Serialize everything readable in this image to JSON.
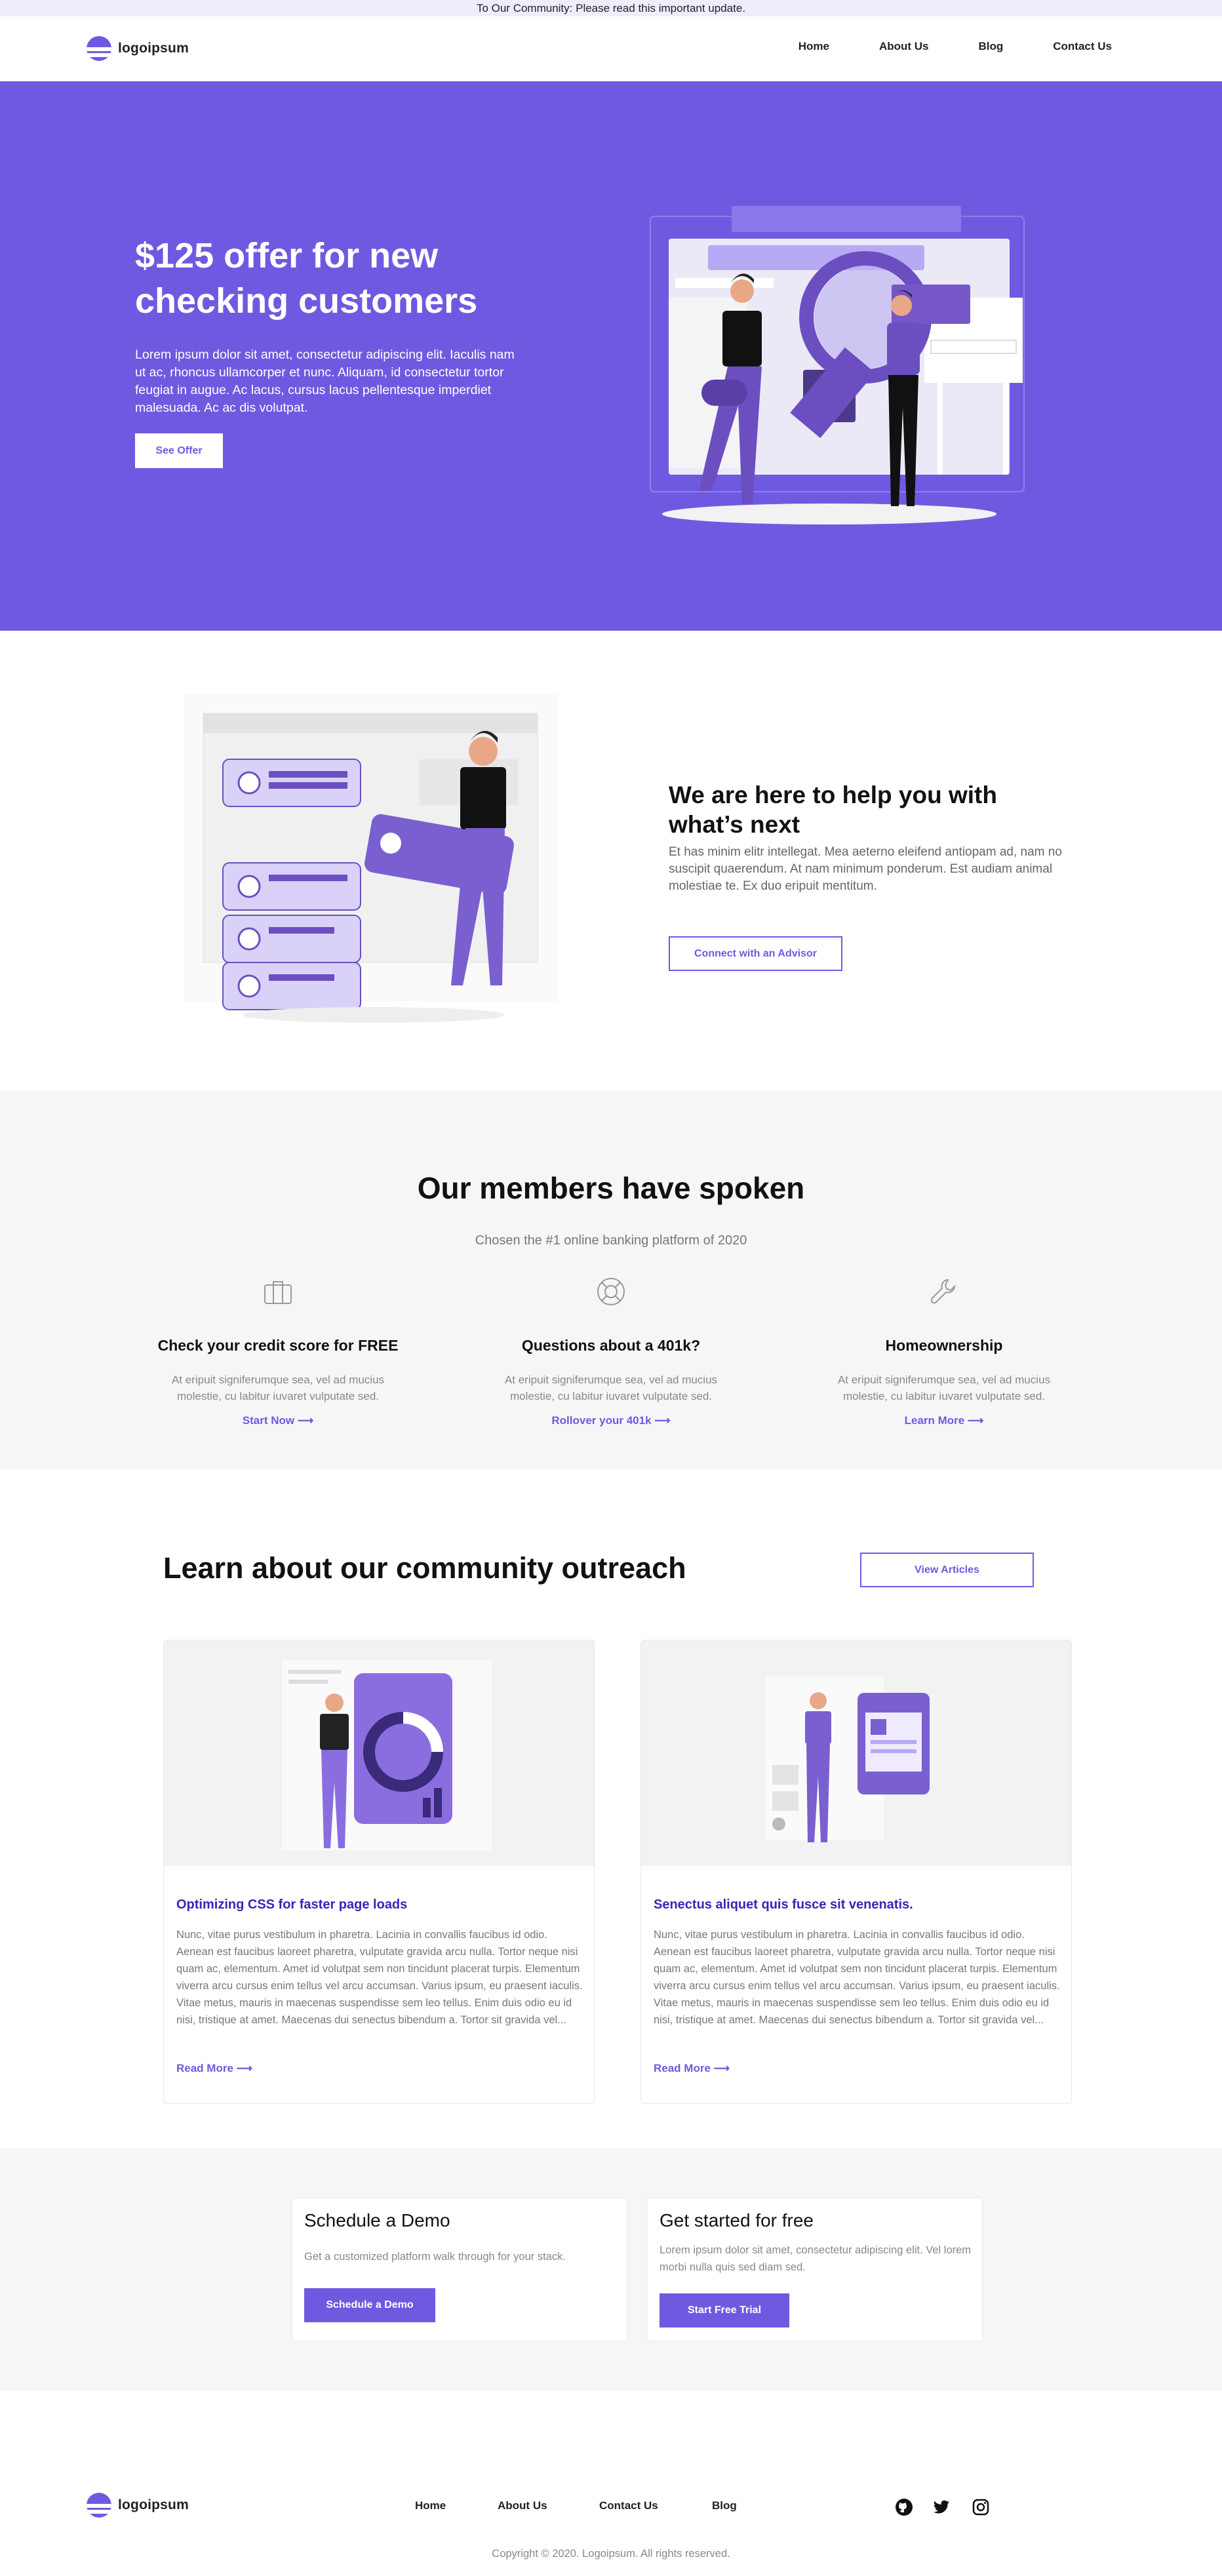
{
  "announcement": {
    "text": "To Our Community: Please read this important update."
  },
  "brand": {
    "name": "logoipsum",
    "accent": "#6e5ae0"
  },
  "nav": {
    "links": [
      "Home",
      "About Us",
      "Blog",
      "Contact Us"
    ]
  },
  "hero": {
    "title": "$125 offer for new checking customers",
    "body": "Lorem ipsum dolor sit amet, consectetur adipiscing elit. Iaculis nam ut ac, rhoncus ullamcorper et nunc. Aliquam, id consectetur tortor feugiat in augue. Ac lacus, cursus lacus pellentesque imperdiet malesuada. Ac ac dis volutpat.",
    "button": "See Offer"
  },
  "help": {
    "title": "We are here to help you with what’s next",
    "body": "Et has minim elitr intellegat. Mea aeterno eleifend antiopam ad, nam no suscipit quaerendum. At nam minimum ponderum. Est audiam animal molestiae te. Ex duo eripuit mentitum.",
    "button": "Connect with an Advisor"
  },
  "members": {
    "title": "Our members have spoken",
    "subtitle": "Chosen the #1 online banking platform of 2020",
    "features": [
      {
        "icon": "briefcase-icon",
        "title": "Check your credit score for FREE",
        "body": "At eripuit signiferumque sea, vel ad mucius molestie, cu labitur iuvaret vulputate sed.",
        "link": "Start Now ⟶"
      },
      {
        "icon": "lifebuoy-icon",
        "title": "Questions about a 401k?",
        "body": "At eripuit signiferumque sea, vel ad mucius molestie, cu labitur iuvaret vulputate sed.",
        "link": "Rollover your 401k ⟶"
      },
      {
        "icon": "wrench-icon",
        "title": "Homeownership",
        "body": "At eripuit signiferumque sea, vel ad mucius molestie, cu labitur iuvaret vulputate sed.",
        "link": "Learn More ⟶"
      }
    ]
  },
  "outreach": {
    "title": "Learn about our community outreach",
    "button": "View Articles",
    "articles": [
      {
        "title": "Optimizing CSS for faster page loads",
        "body": "Nunc, vitae purus vestibulum in pharetra. Lacinia in convallis faucibus id odio. Aenean est faucibus laoreet pharetra, vulputate gravida arcu nulla. Tortor neque nisi quam ac, elementum. Amet id volutpat sem non tincidunt placerat turpis. Elementum viverra arcu cursus enim tellus vel arcu accumsan. Varius ipsum, eu praesent iaculis. Vitae metus, mauris in maecenas suspendisse sem leo tellus. Enim duis odio eu id nisi, tristique at amet. Maecenas dui senectus bibendum a. Tortor sit gravida vel...",
        "link": "Read More ⟶"
      },
      {
        "title": "Senectus aliquet quis fusce sit venenatis.",
        "body": "Nunc, vitae purus vestibulum in pharetra. Lacinia in convallis faucibus id odio. Aenean est faucibus laoreet pharetra, vulputate gravida arcu nulla. Tortor neque nisi quam ac, elementum. Amet id volutpat sem non tincidunt placerat turpis. Elementum viverra arcu cursus enim tellus vel arcu accumsan. Varius ipsum, eu praesent iaculis. Vitae metus, mauris in maecenas suspendisse sem leo tellus. Enim duis odio eu id nisi, tristique at amet. Maecenas dui senectus bibendum a. Tortor sit gravida vel...",
        "link": "Read More ⟶"
      }
    ]
  },
  "cta": {
    "demo": {
      "title": "Schedule a Demo",
      "body": "Get a customized platform walk through for your stack.",
      "button": "Schedule a Demo"
    },
    "trial": {
      "title": "Get started for free",
      "body": "Lorem ipsum dolor sit amet, consectetur adipiscing elit. Vel lorem morbi nulla quis sed diam sed.",
      "button": "Start Free Trial"
    }
  },
  "footer": {
    "links": [
      "Home",
      "About Us",
      "Contact Us",
      "Blog"
    ],
    "social": [
      "github-icon",
      "twitter-icon",
      "instagram-icon"
    ],
    "copyright": "Copyright © 2020. Logoipsum. All rights reserved."
  }
}
